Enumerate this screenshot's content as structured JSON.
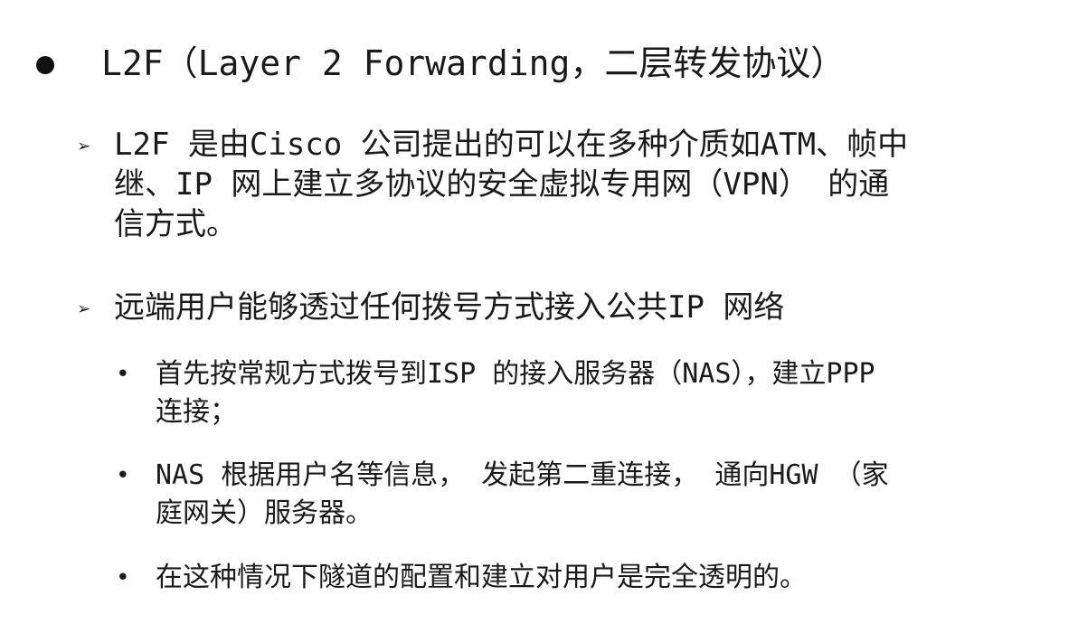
{
  "heading": {
    "text": "L2F（Layer 2 Forwarding，二层转发协议）"
  },
  "points": [
    {
      "marker": "➢",
      "text": "L2F 是由Cisco 公司提出的可以在多种介质如ATM、帧中\n继、IP 网上建立多协议的安全虚拟专用网（VPN） 的通\n信方式。"
    },
    {
      "marker": "➢",
      "text": "远端用户能够透过任何拨号方式接入公共IP 网络"
    }
  ],
  "subpoints": [
    {
      "marker": "•",
      "text": " 首先按常规方式拨号到ISP 的接入服务器（NAS），建立PPP\n连接；"
    },
    {
      "marker": "•",
      "text": " NAS 根据用户名等信息， 发起第二重连接， 通向HGW （家\n庭网关）服务器。"
    },
    {
      "marker": "•",
      "text": " 在这种情况下隧道的配置和建立对用户是完全透明的。"
    }
  ]
}
